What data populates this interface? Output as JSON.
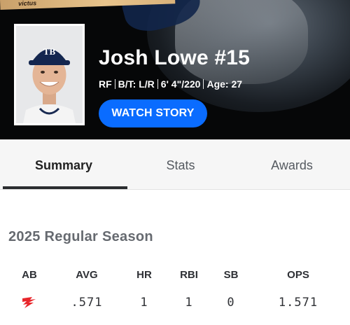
{
  "header": {
    "bat_brand": "victus",
    "player_name": "Josh Lowe #15",
    "bio": {
      "position": "RF",
      "bats_throws": "B/T: L/R",
      "height_weight": "6' 4\"/220",
      "age": "Age: 27"
    },
    "watch_button": "WATCH STORY",
    "accent_color": "#0a6cff"
  },
  "tabs": [
    {
      "label": "Summary",
      "selected": true
    },
    {
      "label": "Stats",
      "selected": false
    },
    {
      "label": "Awards",
      "selected": false
    }
  ],
  "season": {
    "title": "2025 Regular Season",
    "columns": [
      "AB",
      "AVG",
      "HR",
      "RBI",
      "SB",
      "OPS"
    ],
    "values": {
      "ab_icon": "red-flame-logo-icon",
      "avg": ".571",
      "hr": "1",
      "rbi": "1",
      "sb": "0",
      "ops": "1.571"
    }
  }
}
